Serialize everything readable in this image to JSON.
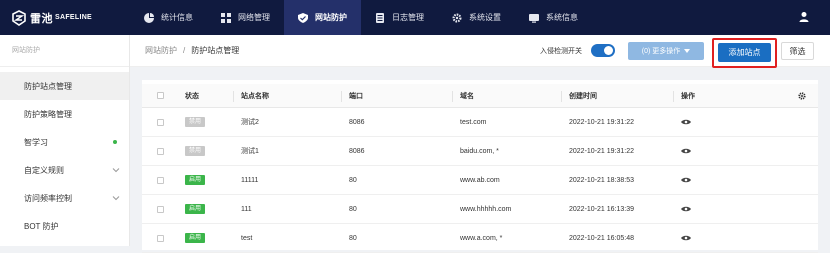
{
  "brand": {
    "cn": "雷池",
    "en": "SAFELINE"
  },
  "nav": [
    {
      "label": "统计信息",
      "icon": "chart-pie-icon",
      "active": false
    },
    {
      "label": "网络管理",
      "icon": "network-grid-icon",
      "active": false
    },
    {
      "label": "网站防护",
      "icon": "shield-check-icon",
      "active": true
    },
    {
      "label": "日志管理",
      "icon": "log-list-icon",
      "active": false
    },
    {
      "label": "系统设置",
      "icon": "gear-icon",
      "active": false
    },
    {
      "label": "系统信息",
      "icon": "monitor-icon",
      "active": false
    }
  ],
  "sidebar": {
    "header": "网站防护",
    "items": [
      {
        "label": "防护站点管理",
        "active": true
      },
      {
        "label": "防护策略管理",
        "active": false
      },
      {
        "label": "智学习",
        "indicator": "green-dot"
      },
      {
        "label": "自定义规则",
        "expandable": true
      },
      {
        "label": "访问频率控制",
        "expandable": true
      },
      {
        "label": "BOT 防护"
      }
    ]
  },
  "breadcrumb": {
    "parent": "网站防护",
    "separator": "/",
    "current": "防护站点管理"
  },
  "toolbar": {
    "ids_label": "入侵检测开关",
    "ids_enabled": true,
    "more_label": "(0) 更多操作",
    "add_label": "添加站点",
    "filter_label": "筛选"
  },
  "table": {
    "columns": [
      "状态",
      "站点名称",
      "端口",
      "域名",
      "创建时间",
      "操作"
    ],
    "rows": [
      {
        "status": "禁用",
        "enabled": false,
        "name": "测试2",
        "port": "8086",
        "domain": "test.com",
        "created": "2022-10-21 19:31:22"
      },
      {
        "status": "禁用",
        "enabled": false,
        "name": "测试1",
        "port": "8086",
        "domain": "baidu.com, *",
        "created": "2022-10-21 19:31:22"
      },
      {
        "status": "启用",
        "enabled": true,
        "name": "11111",
        "port": "80",
        "domain": "www.ab.com",
        "created": "2022-10-21 18:38:53"
      },
      {
        "status": "启用",
        "enabled": true,
        "name": "111",
        "port": "80",
        "domain": "www.hhhhh.com",
        "created": "2022-10-21 16:13:39"
      },
      {
        "status": "启用",
        "enabled": true,
        "name": "test",
        "port": "80",
        "domain": "www.a.com, *",
        "created": "2022-10-21 16:05:48"
      }
    ]
  },
  "colors": {
    "topbar": "#101a3f",
    "primary": "#1a6ec2",
    "enabled": "#3bb54a",
    "disabled": "#c8c8c8",
    "highlight": "#e02020"
  }
}
